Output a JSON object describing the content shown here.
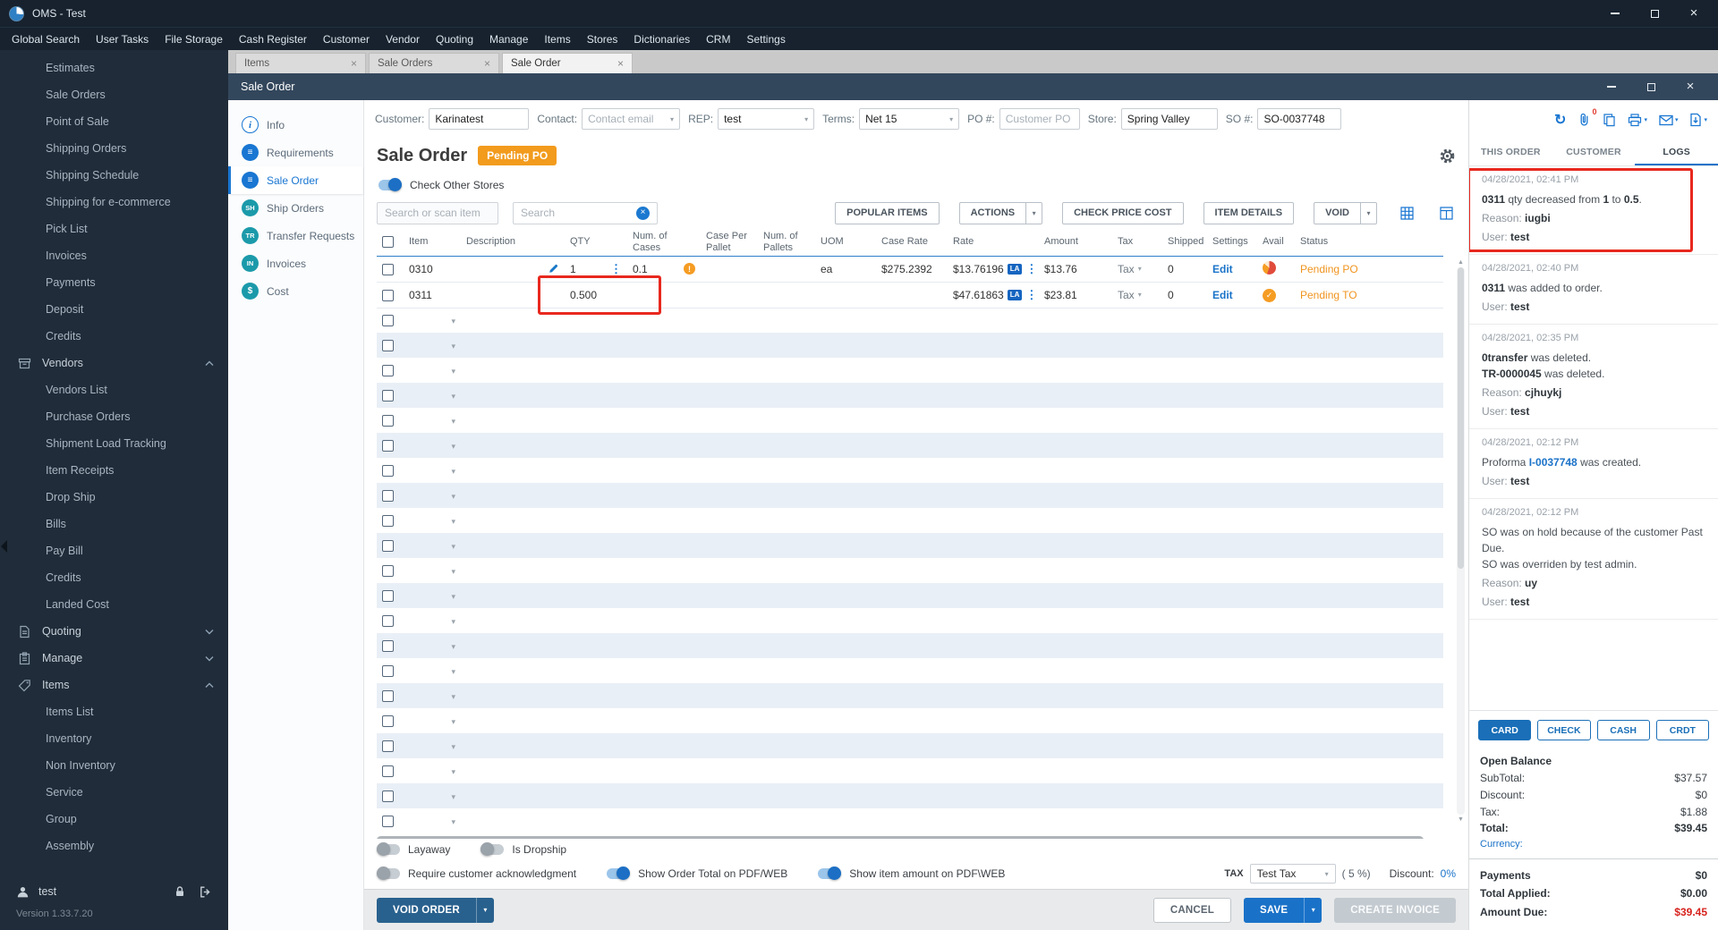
{
  "app": {
    "title": "OMS - Test",
    "menu": [
      "Global Search",
      "User Tasks",
      "File Storage",
      "Cash Register",
      "Customer",
      "Vendor",
      "Quoting",
      "Manage",
      "Items",
      "Stores",
      "Dictionaries",
      "CRM",
      "Settings"
    ]
  },
  "sidebar": {
    "top_items": [
      "Estimates",
      "Sale Orders",
      "Point of Sale",
      "Shipping Orders",
      "Shipping Schedule",
      "Shipping for e-commerce",
      "Pick List",
      "Invoices",
      "Payments",
      "Deposit",
      "Credits"
    ],
    "groups": [
      {
        "label": "Vendors",
        "icon": "vendors-icon",
        "expanded": true,
        "items": [
          "Vendors List",
          "Purchase Orders",
          "Shipment Load Tracking",
          "Item Receipts",
          "Drop Ship",
          "Bills",
          "Pay Bill",
          "Credits",
          "Landed Cost"
        ]
      },
      {
        "label": "Quoting",
        "icon": "quoting-icon",
        "expanded": false,
        "items": []
      },
      {
        "label": "Manage",
        "icon": "manage-icon",
        "expanded": false,
        "items": []
      },
      {
        "label": "Items",
        "icon": "items-icon",
        "expanded": true,
        "items": [
          "Items List",
          "Inventory",
          "Non Inventory",
          "Service",
          "Group",
          "Assembly"
        ]
      }
    ],
    "user": "test",
    "version": "Version 1.33.7.20"
  },
  "tab_bar": [
    {
      "label": "Items",
      "active": false
    },
    {
      "label": "Sale Orders",
      "active": false
    },
    {
      "label": "Sale Order",
      "active": true
    }
  ],
  "window_title": "Sale Order",
  "form": {
    "customer": {
      "label": "Customer:",
      "value": "Karinatest"
    },
    "contact": {
      "label": "Contact:",
      "placeholder": "Contact email"
    },
    "rep": {
      "label": "REP:",
      "value": "test"
    },
    "terms": {
      "label": "Terms:",
      "value": "Net 15"
    },
    "po": {
      "label": "PO #:",
      "placeholder": "Customer PO"
    },
    "store": {
      "label": "Store:",
      "value": "Spring Valley"
    },
    "so": {
      "label": "SO #:",
      "value": "SO-0037748"
    }
  },
  "attachments_count": "0",
  "inner_nav": [
    {
      "label": "Info",
      "glyph": "i",
      "active": false
    },
    {
      "label": "Requirements",
      "glyph": "≡",
      "active": false
    },
    {
      "label": "Sale Order",
      "glyph": "≡",
      "active": true
    },
    {
      "label": "Ship Orders",
      "glyph": "SH",
      "active": false
    },
    {
      "label": "Transfer Requests",
      "glyph": "TR",
      "active": false
    },
    {
      "label": "Invoices",
      "glyph": "IN",
      "active": false
    },
    {
      "label": "Cost",
      "glyph": "$",
      "active": false
    }
  ],
  "order_header": {
    "title": "Sale Order",
    "badge": "Pending PO",
    "check_other_stores": "Check Other Stores"
  },
  "search": {
    "scan_placeholder": "Search or scan item",
    "search_placeholder": "Search"
  },
  "toolbar": {
    "popular_items": "POPULAR ITEMS",
    "actions": "ACTIONS",
    "check_price_cost": "CHECK PRICE COST",
    "item_details": "ITEM DETAILS",
    "void": "VOID"
  },
  "table": {
    "columns": [
      "Item",
      "Description",
      "QTY",
      "Num. of Cases",
      "Case Per Pallet",
      "Num. of Pallets",
      "UOM",
      "Case Rate",
      "Rate",
      "Amount",
      "Tax",
      "Shipped",
      "Settings",
      "Avail",
      "Status"
    ],
    "rows": [
      {
        "item": "0310",
        "qty": "1",
        "num_cases": "0.1",
        "uom": "ea",
        "case_rate": "$275.2392",
        "rate": "$13.76196",
        "rate_badge": "LA",
        "amount": "$13.76",
        "tax": "Tax",
        "shipped": "0",
        "settings": "Edit",
        "status": "Pending PO"
      },
      {
        "item": "0311",
        "qty": "0.500",
        "num_cases": "",
        "uom": "",
        "case_rate": "",
        "rate": "$47.61863",
        "rate_badge": "LA",
        "amount": "$23.81",
        "tax": "Tax",
        "shipped": "0",
        "settings": "Edit",
        "status": "Pending TO"
      }
    ]
  },
  "options": {
    "layaway": {
      "label": "Layaway",
      "on": false
    },
    "is_dropship": {
      "label": "Is Dropship",
      "on": false
    },
    "require_ack": {
      "label": "Require customer acknowledgment",
      "on": false
    },
    "show_order_total": {
      "label": "Show Order Total on PDF/WEB",
      "on": true
    },
    "show_item_amount": {
      "label": "Show item amount on PDF\\WEB",
      "on": true
    }
  },
  "tax_bar": {
    "label": "TAX",
    "value": "Test Tax",
    "percent": "( 5 %)",
    "discount_label": "Discount:",
    "discount_value": "0%"
  },
  "footer_actions": {
    "void_order": "VOID ORDER",
    "cancel": "CANCEL",
    "save": "SAVE",
    "create_invoice": "CREATE INVOICE"
  },
  "right_panel": {
    "tabs": [
      {
        "label": "THIS ORDER",
        "active": false
      },
      {
        "label": "CUSTOMER",
        "active": false
      },
      {
        "label": "LOGS",
        "active": true
      }
    ],
    "reason_label": "Reason: ",
    "user_label": "User: ",
    "logs": [
      {
        "date": "04/28/2021, 02:41 PM",
        "highlight": true,
        "lines": [
          [
            [
              "0311",
              1
            ],
            [
              " qty decreased from ",
              0
            ],
            [
              "1",
              1
            ],
            [
              " to ",
              0
            ],
            [
              "0.5",
              1
            ],
            [
              ".",
              0
            ]
          ]
        ],
        "reason": "iugbi",
        "user": "test"
      },
      {
        "date": "04/28/2021, 02:40 PM",
        "lines": [
          [
            [
              "0311",
              1
            ],
            [
              " was added to order.",
              0
            ]
          ]
        ],
        "user": "test"
      },
      {
        "date": "04/28/2021, 02:35 PM",
        "lines": [
          [
            [
              "0transfer",
              1
            ],
            [
              " was deleted.",
              0
            ]
          ],
          [
            [
              "TR-0000045",
              1
            ],
            [
              " was deleted.",
              0
            ]
          ]
        ],
        "reason": "cjhuykj",
        "user": "test"
      },
      {
        "date": "04/28/2021, 02:12 PM",
        "lines": [
          [
            [
              "Proforma ",
              0
            ],
            [
              "I-0037748",
              2
            ],
            [
              " was created.",
              0
            ]
          ]
        ],
        "user": "test"
      },
      {
        "date": "04/28/2021, 02:12 PM",
        "lines": [
          [
            [
              "SO was on hold because of the customer Past Due.",
              0
            ]
          ],
          [
            [
              "SO was overriden by test admin.",
              0
            ]
          ]
        ],
        "reason": "uy",
        "user": "test"
      }
    ],
    "payment_buttons": [
      "CARD",
      "CHECK",
      "CASH",
      "CRDT"
    ],
    "balance": {
      "title": "Open Balance",
      "rows": [
        {
          "label": "SubTotal:",
          "value": "$37.57"
        },
        {
          "label": "Discount:",
          "value": "$0"
        },
        {
          "label": "Tax:",
          "value": "$1.88"
        },
        {
          "label": "Total:",
          "value": "$39.45",
          "bold": true
        }
      ],
      "currency_label": "Currency:"
    },
    "payments": [
      {
        "label": "Payments",
        "value": "$0"
      },
      {
        "label": "Total Applied:",
        "value": "$0.00"
      },
      {
        "label": "Amount Due:",
        "value": "$39.45",
        "due": true
      }
    ]
  }
}
